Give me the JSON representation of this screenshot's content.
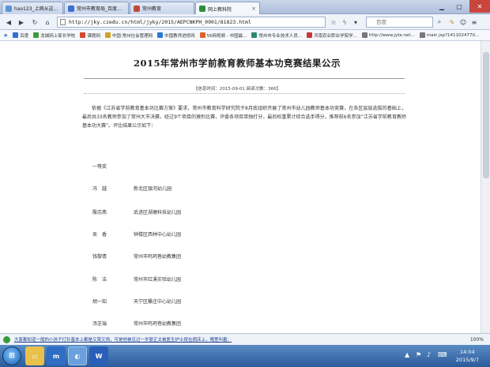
{
  "browser": {
    "tabs": [
      {
        "label": "hao123_上网从这里开始",
        "color": "#5c93d6"
      },
      {
        "label": "常州市教育局_百度搜索",
        "color": "#3d6fd1"
      },
      {
        "label": "常州教育",
        "color": "#c24a3b"
      },
      {
        "label": "网上教科院",
        "color": "#2b8f3c"
      }
    ],
    "url": "http://jky.czedu.cn/html/jyky/2015/AEPCNKPH_0901/81823.html",
    "search_placeholder": "百度",
    "bookmarks": [
      {
        "label": "百度",
        "color": "#2f6fd8"
      },
      {
        "label": "龙城网上家长学校",
        "color": "#3a9a3a"
      },
      {
        "label": "课题网",
        "color": "#d04a2a"
      },
      {
        "label": "中国·常州社会管理网",
        "color": "#d2a22a"
      },
      {
        "label": "中国教师进修网",
        "color": "#2a7ad2"
      },
      {
        "label": "56网视频 - 中国最...",
        "color": "#e2622a"
      },
      {
        "label": "常州市专业技术人员...",
        "color": "#2a8a6a"
      },
      {
        "label": "河南农业职业学院学...",
        "color": "#c23a3a"
      },
      {
        "label": "http://www.jyte.net...",
        "color": "#777777"
      },
      {
        "label": "main.jsp?1411024770...",
        "color": "#777777"
      }
    ],
    "status_message": "大家都知道一般的小孩子打针基本上都是又哭又闹，可是他被见过一岁婴正太被医生护士按在病床上，嘴里叫着：",
    "zoom": "100%"
  },
  "article": {
    "title": "2015年常州市学前教育教师基本功竞赛结果公示",
    "meta": "【信息时间：2015-09-01    阅读次数：366】",
    "paragraph": "依据《江苏省学前教育基本功比赛方案》要求，常州市教育科学研究院于8月底组织开展了常州市幼儿园教师基本功竞赛，在各区层层选拔的基础上，最后共33名教师参加了常州大市决赛，经过9个项目的激烈比赛，评委各项目单独打分，最后权重累计综合选手得分，推荐前6名参加“江苏省学前教育教师基本功大赛”。评比结果公示如下：",
    "section": "一等奖",
    "winners": [
      {
        "name": "冯　越",
        "school": "新北区银河幼儿园"
      },
      {
        "name": "殷志燕",
        "school": "武进区湖塘科技幼儿园"
      },
      {
        "name": "吴　香",
        "school": "钟楼区西林中心幼儿园"
      },
      {
        "name": "钱黎倩",
        "school": "常州市鸣珂巷幼教集团"
      },
      {
        "name": "陈　洁",
        "school": "常州市红溪实验幼儿园"
      },
      {
        "name": "胡一知",
        "school": "天宁区雕庄中心幼儿园"
      },
      {
        "name": "汤芝瑞",
        "school": "常州市鸣珂巷幼教集团"
      }
    ]
  },
  "taskbar": {
    "clock_time": "14:04",
    "clock_date": "2015/9/7"
  }
}
